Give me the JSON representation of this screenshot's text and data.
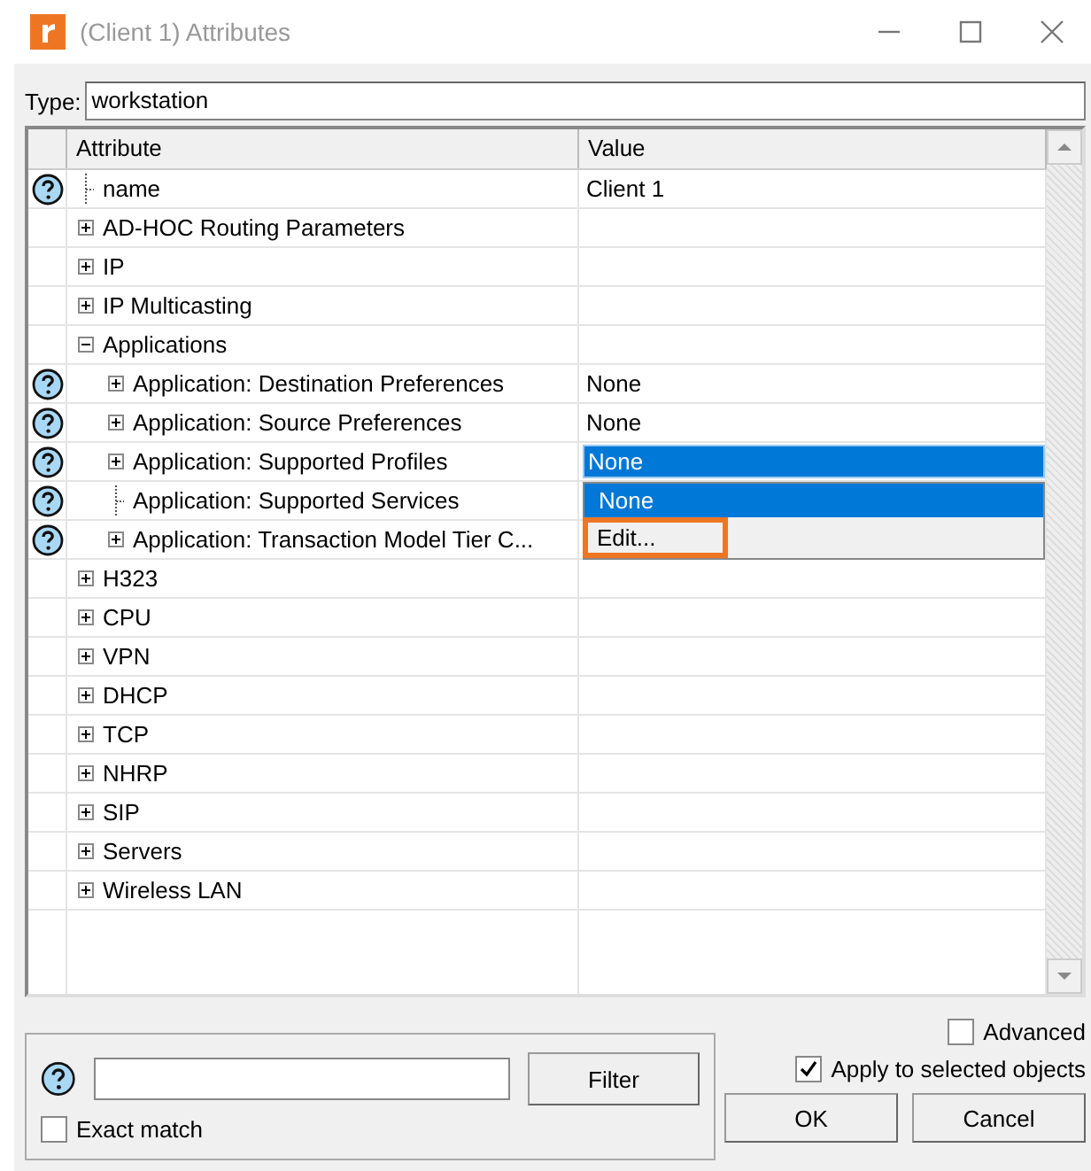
{
  "window": {
    "title": "(Client 1) Attributes"
  },
  "type": {
    "label": "Type:",
    "value": "workstation"
  },
  "table": {
    "columns": [
      "Attribute",
      "Value"
    ],
    "rows": [
      {
        "kind": "leaf",
        "help": true,
        "label": "name",
        "value": "Client 1"
      },
      {
        "kind": "group",
        "help": false,
        "expanded": false,
        "label": "AD-HOC Routing Parameters"
      },
      {
        "kind": "group",
        "help": false,
        "expanded": false,
        "label": "IP"
      },
      {
        "kind": "group",
        "help": false,
        "expanded": false,
        "label": "IP Multicasting"
      },
      {
        "kind": "group",
        "help": false,
        "expanded": true,
        "label": "Applications",
        "children": [
          {
            "kind": "group",
            "help": true,
            "expanded": false,
            "label": "Application: Destination Preferences",
            "value": "None"
          },
          {
            "kind": "group",
            "help": true,
            "expanded": false,
            "label": "Application: Source Preferences",
            "value": "None"
          },
          {
            "kind": "group",
            "help": true,
            "expanded": false,
            "label": "Application: Supported Profiles",
            "value": "None",
            "selected": true,
            "dropdown": [
              {
                "label": "None",
                "selected": true,
                "highlighted": false
              },
              {
                "label": "Edit...",
                "selected": false,
                "highlighted": true
              }
            ]
          },
          {
            "kind": "leaf",
            "help": true,
            "label": "Application: Supported Services"
          },
          {
            "kind": "group",
            "help": true,
            "expanded": false,
            "label": "Application: Transaction Model Tier C..."
          }
        ]
      },
      {
        "kind": "group",
        "help": false,
        "expanded": false,
        "label": "H323"
      },
      {
        "kind": "group",
        "help": false,
        "expanded": false,
        "label": "CPU"
      },
      {
        "kind": "group",
        "help": false,
        "expanded": false,
        "label": "VPN"
      },
      {
        "kind": "group",
        "help": false,
        "expanded": false,
        "label": "DHCP"
      },
      {
        "kind": "group",
        "help": false,
        "expanded": false,
        "label": "TCP"
      },
      {
        "kind": "group",
        "help": false,
        "expanded": false,
        "label": "NHRP"
      },
      {
        "kind": "group",
        "help": false,
        "expanded": false,
        "label": "SIP"
      },
      {
        "kind": "group",
        "help": false,
        "expanded": false,
        "label": "Servers"
      },
      {
        "kind": "group",
        "help": false,
        "expanded": false,
        "label": "Wireless LAN"
      }
    ]
  },
  "filter": {
    "button": {
      "label": "Filter"
    },
    "exact_match": {
      "label": "Exact match",
      "checked": false
    }
  },
  "advanced": {
    "label": "Advanced",
    "checked": false
  },
  "apply_to_selected": {
    "label": "Apply to selected objects",
    "checked": true
  },
  "buttons": [
    {
      "label": "OK"
    },
    {
      "label": "Cancel"
    }
  ]
}
